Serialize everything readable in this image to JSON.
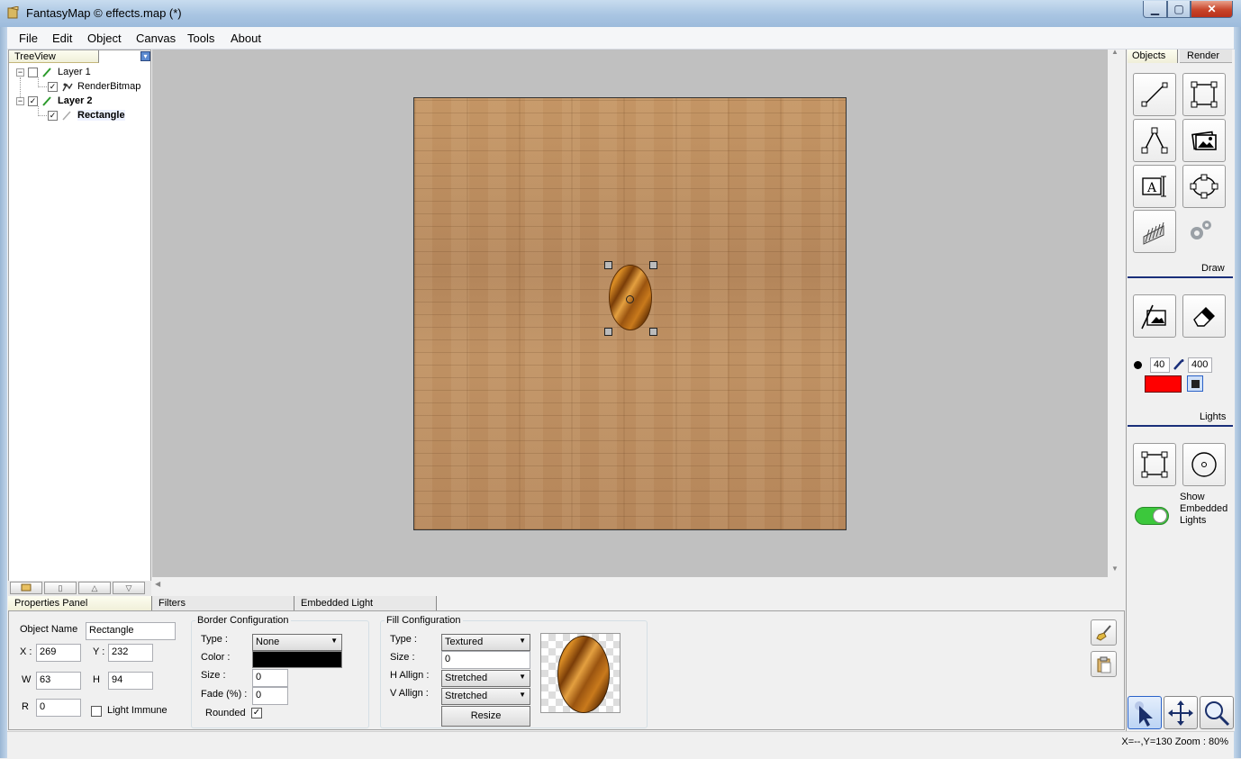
{
  "window": {
    "title": "FantasyMap © effects.map (*)",
    "min_icon": "minimize-icon",
    "max_icon": "maximize-icon",
    "close_icon": "close-icon",
    "min_glyph": "▁",
    "max_glyph": "▢",
    "close_glyph": "✕"
  },
  "menu": [
    "File",
    "Edit",
    "Object",
    "Canvas",
    "Tools",
    "About"
  ],
  "treeview": {
    "tab_label": "TreeView",
    "nodes": [
      {
        "label": "Layer 1",
        "checked": false,
        "bold": false
      },
      {
        "label": "RenderBitmap",
        "checked": true,
        "bold": false
      },
      {
        "label": "Layer 2",
        "checked": true,
        "bold": true
      },
      {
        "label": "Rectangle",
        "checked": true,
        "bold": true
      }
    ],
    "expander_glyph": "−"
  },
  "right_panel": {
    "tabs": [
      "Objects",
      "Render"
    ],
    "sections": {
      "draw": "Draw",
      "lights": "Lights"
    },
    "brush": {
      "size": "40",
      "size2": "400",
      "color": "#ff0000"
    },
    "toggle": {
      "label": "Show Embedded Lights",
      "on": true,
      "color": "#3cc83c"
    }
  },
  "properties": {
    "tabs": [
      "Properties Panel",
      "Filters",
      "Embedded Light"
    ],
    "object_name_label": "Object Name",
    "object_name": "Rectangle",
    "x_label": "X :",
    "x": "269",
    "y_label": "Y :",
    "y": "232",
    "w_label": "W",
    "w": "63",
    "h_label": "H",
    "h": "94",
    "r_label": "R",
    "r": "0",
    "light_immune_label": "Light Immune",
    "border": {
      "title": "Border Configuration",
      "type_label": "Type :",
      "type": "None",
      "color_label": "Color :",
      "color": "#000000",
      "size_label": "Size :",
      "size": "0",
      "fade_label": "Fade (%) :",
      "fade": "0",
      "rounded_label": "Rounded",
      "rounded": true
    },
    "fill": {
      "title": "Fill Configuration",
      "type_label": "Type :",
      "type": "Textured",
      "size_label": "Size :",
      "size": "0",
      "h_align_label": "H Allign :",
      "h_align": "Stretched",
      "v_align_label": "V Allign :",
      "v_align": "Stretched",
      "resize_label": "Resize"
    },
    "dropdown_glyph": "▼",
    "check_glyph": "✓"
  },
  "status": {
    "text": "X=--,Y=130  Zoom : 80%"
  }
}
